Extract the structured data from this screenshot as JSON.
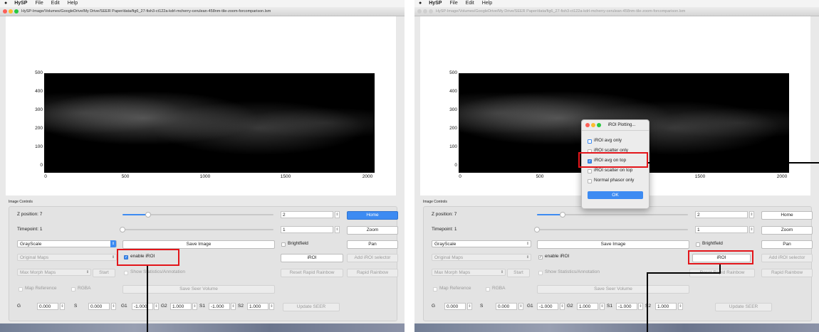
{
  "menubar": {
    "app": "HySP",
    "items": [
      "File",
      "Edit",
      "Help"
    ]
  },
  "window_title": "HySP-Image/Volumes/GoogleDrive/My Drive/SEER Paper/data/fig6_27-fish3-ct122a-kdrl-mcherry-cerulean-458nm-tile-zoom-forcomparison.lsm",
  "image_plot": {
    "y_ticks": [
      "500",
      "400",
      "300",
      "200",
      "100",
      "0"
    ],
    "x_ticks": [
      "0",
      "500",
      "1000",
      "1500",
      "2000"
    ]
  },
  "controls": {
    "group_label": "Image Controls",
    "z_position_label": "Z position: 7",
    "z_value": "2",
    "z_slider_fraction": 0.17,
    "timepoint_label": "Timepoint: 1",
    "timepoint_value": "1",
    "timepoint_slider_fraction": 0.0,
    "colormap": "GrayScale",
    "save_image": "Save Image",
    "brightfield": "Brightfield",
    "pan": "Pan",
    "home": "Home",
    "zoom": "Zoom",
    "original_maps": "Original Maps",
    "enable_iroi": "enable iROI",
    "iroi": "iROI",
    "add_iroi_selector": "Add iROI selector",
    "max_morph_maps": "Max Morph Maps",
    "start": "Start",
    "show_stats": "Show Statistics/Annotation",
    "reset_rapid_rainbow": "Reset Rapid Rainbow",
    "rapid_rainbow": "Rapid Rainbow",
    "map_reference": "Map Reference",
    "rgba": "RGBA",
    "save_seer_volume": "Save Seer Volume",
    "g_label": "G",
    "g_value": "0.000",
    "s_label": "S",
    "s_value": "0.000",
    "g1_label": "G1",
    "g1_value": "-1.000",
    "g2_label": "G2",
    "g2_value": "1.000",
    "s1_label": "S1",
    "s1_value": "-1.000",
    "s2_label": "S2",
    "s2_value": "1.000",
    "update_seer": "Update SEER"
  },
  "dialog": {
    "title": "iROI Plotting...",
    "options": [
      "iROI avg only",
      "iROI scatter only",
      "iROI avg on top",
      "iROI scatter on top",
      "Normal phasor only"
    ],
    "ok": "OK"
  }
}
